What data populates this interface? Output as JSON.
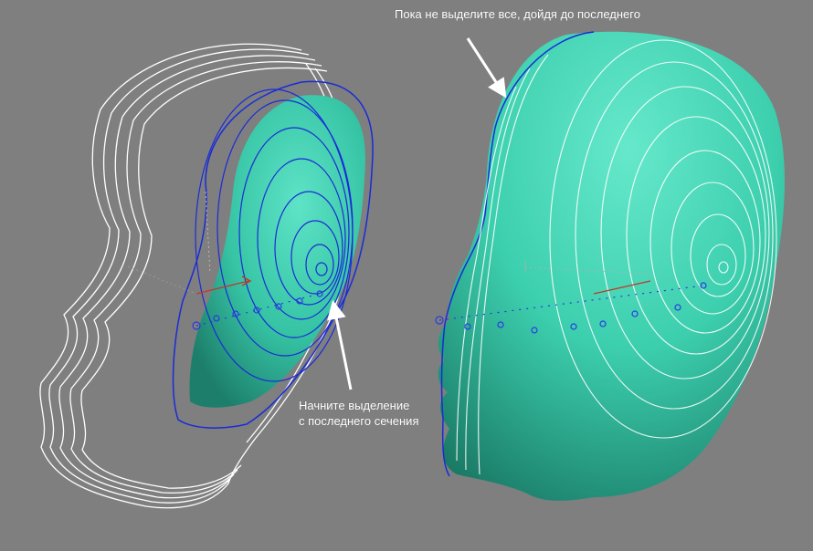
{
  "annotations": {
    "top": "Пока не выделите все, дойдя до последнего",
    "bottom_line1": "Начните выделение",
    "bottom_line2": "с последнего сечения"
  },
  "colors": {
    "viewport_background": "#7f7f7f",
    "surface": "#3fd0b0",
    "wireframe_contours": "#ffffff",
    "selected_contours": "#1a2bd6",
    "gizmo_x_axis": "#c0392b",
    "annotation_text": "#ffffff"
  },
  "icons": {
    "arrow_top": "pointer-arrow",
    "arrow_bottom": "pointer-arrow",
    "transform_gizmo": "axis-gizmo"
  }
}
